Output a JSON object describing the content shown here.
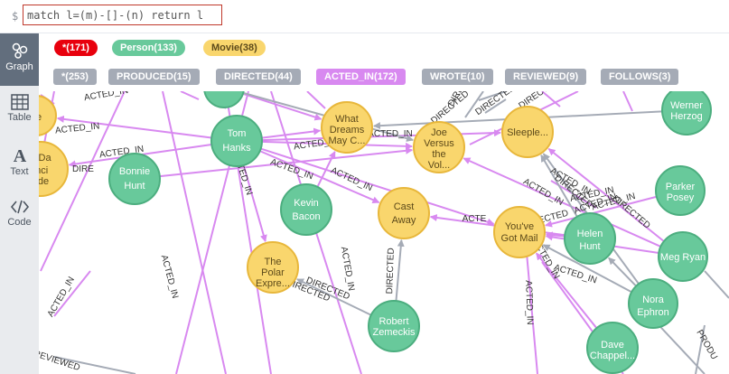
{
  "command": {
    "prompt": "$",
    "query": "match l=(m)-[]-(n) return l"
  },
  "sidebar": {
    "items": [
      {
        "label": "Graph",
        "icon": "graph-icon",
        "active": true
      },
      {
        "label": "Table",
        "icon": "table-icon",
        "active": false
      },
      {
        "label": "Text",
        "icon": "text-icon",
        "active": false
      },
      {
        "label": "Code",
        "icon": "code-icon",
        "active": false
      }
    ]
  },
  "legend": {
    "node_labels": [
      {
        "text": "*(171)",
        "color": "#e8000d",
        "text_color": "#ffffff"
      },
      {
        "text": "Person(133)",
        "color": "#68c99b",
        "text_color": "#ffffff"
      },
      {
        "text": "Movie(38)",
        "color": "#f9d66d",
        "text_color": "#5d4a1a"
      }
    ],
    "relationship_types": [
      {
        "text": "*(253)",
        "color": "#a5abb6",
        "text_color": "#ffffff"
      },
      {
        "text": "PRODUCED(15)",
        "color": "#a5abb6",
        "text_color": "#ffffff"
      },
      {
        "text": "DIRECTED(44)",
        "color": "#a5abb6",
        "text_color": "#ffffff"
      },
      {
        "text": "ACTED_IN(172)",
        "color": "#d889f0",
        "text_color": "#ffffff"
      },
      {
        "text": "WROTE(10)",
        "color": "#a5abb6",
        "text_color": "#ffffff"
      },
      {
        "text": "REVIEWED(9)",
        "color": "#a5abb6",
        "text_color": "#ffffff"
      },
      {
        "text": "FOLLOWS(3)",
        "color": "#a5abb6",
        "text_color": "#ffffff"
      }
    ]
  },
  "colors": {
    "person": "#68c99b",
    "person_border": "#4cae7f",
    "movie": "#f9d66d",
    "movie_border": "#e8b73b",
    "acted_in": "#d889f0",
    "other_rel": "#a5abb6"
  },
  "graph": {
    "nodes": [
      {
        "id": "tom",
        "kind": "person",
        "lines": [
          "Tom",
          "Hanks"
        ]
      },
      {
        "id": "bonnie",
        "kind": "person",
        "lines": [
          "Bonnie",
          "Hunt"
        ]
      },
      {
        "id": "kevin",
        "kind": "person",
        "lines": [
          "Kevin",
          "Bacon"
        ]
      },
      {
        "id": "robert",
        "kind": "person",
        "lines": [
          "Robert",
          "Zemeckis"
        ]
      },
      {
        "id": "helen",
        "kind": "person",
        "lines": [
          "Helen",
          "Hunt"
        ]
      },
      {
        "id": "meg",
        "kind": "person",
        "lines": [
          "Meg Ryan"
        ]
      },
      {
        "id": "nora",
        "kind": "person",
        "lines": [
          "Nora",
          "Ephron"
        ]
      },
      {
        "id": "dave",
        "kind": "person",
        "lines": [
          "Dave",
          "Chappel..."
        ]
      },
      {
        "id": "werner",
        "kind": "person",
        "lines": [
          "Werner",
          "Herzog"
        ]
      },
      {
        "id": "parker",
        "kind": "person",
        "lines": [
          "Parker",
          "Posey"
        ]
      },
      {
        "id": "topperson",
        "kind": "person",
        "lines": [
          ""
        ]
      },
      {
        "id": "whatdreams",
        "kind": "movie",
        "lines": [
          "What",
          "Dreams",
          "May C..."
        ]
      },
      {
        "id": "joe",
        "kind": "movie",
        "lines": [
          "Joe",
          "Versus",
          "the",
          "Vol..."
        ]
      },
      {
        "id": "sleepless",
        "kind": "movie",
        "lines": [
          "Sleeple..."
        ]
      },
      {
        "id": "castaway",
        "kind": "movie",
        "lines": [
          "Cast",
          "Away"
        ]
      },
      {
        "id": "youvegot",
        "kind": "movie",
        "lines": [
          "You've",
          "Got Mail"
        ]
      },
      {
        "id": "polar",
        "kind": "movie",
        "lines": [
          "The",
          "Polar",
          "Expre..."
        ]
      },
      {
        "id": "davinci",
        "kind": "movie",
        "lines": [
          "e Da",
          "inci",
          "ode"
        ]
      },
      {
        "id": "leftmovie",
        "kind": "movie",
        "lines": [
          "ge"
        ]
      }
    ],
    "edge_labels": [
      "ACTED_IN",
      "ACTED_IN",
      "ACTED_IN",
      "ACTED_IN",
      "ACTED_IN",
      "ACTED_IN",
      "ACTED_IN",
      "ACTED_IN",
      "ACTED_IN",
      "ACTED_IN",
      "ACTED_IN",
      "ACTED_IN",
      "ACTED_IN",
      "ACTED_IN",
      "ACTED_IN",
      "DIRECTED",
      "DIRECTED",
      "DIRECTED",
      "DIRECTED",
      "DIRECTED",
      "DIRECTED",
      "DIRECTED",
      "DIRECTED",
      "ACTE",
      "ACTED_IN",
      "DIRE",
      "DIRE",
      "DIRECTED",
      "REVIEWED",
      "PRODU",
      "ACTED_IN",
      "ACTED_IN",
      "ACTED_IN"
    ]
  }
}
